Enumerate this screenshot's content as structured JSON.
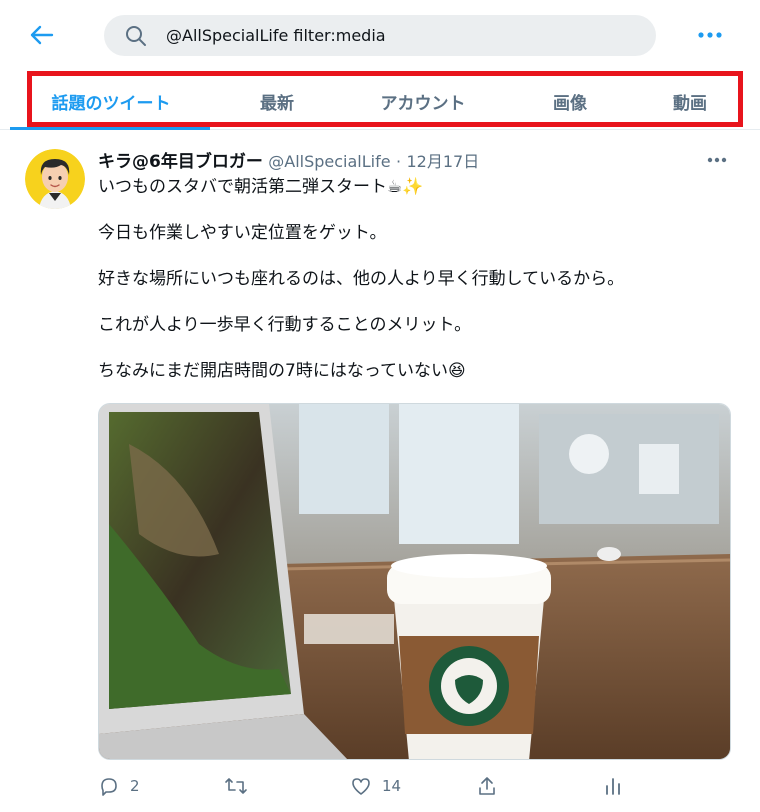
{
  "search": {
    "query": "@AllSpecialLife filter:media"
  },
  "tabs": [
    {
      "label": "話題のツイート",
      "active": true
    },
    {
      "label": "最新",
      "active": false
    },
    {
      "label": "アカウント",
      "active": false
    },
    {
      "label": "画像",
      "active": false
    },
    {
      "label": "動画",
      "active": false
    }
  ],
  "tweet": {
    "author_name": "キラ@6年目ブロガー",
    "handle": "@AllSpecialLife",
    "separator": "·",
    "date": "12月17日",
    "lines": [
      "いつものスタバで朝活第二弾スタート☕✨",
      "今日も作業しやすい定位置をゲット。",
      "好きな場所にいつも座れるのは、他の人より早く行動しているから。",
      "これが人より一歩早く行動することのメリット。",
      "ちなみにまだ開店時間の7時にはなっていない😆"
    ],
    "reply_count": "2",
    "retweet_count": "",
    "like_count": "14"
  },
  "colors": {
    "accent": "#1d9bf0",
    "highlight": "#e8141c",
    "muted": "#5b7083"
  }
}
